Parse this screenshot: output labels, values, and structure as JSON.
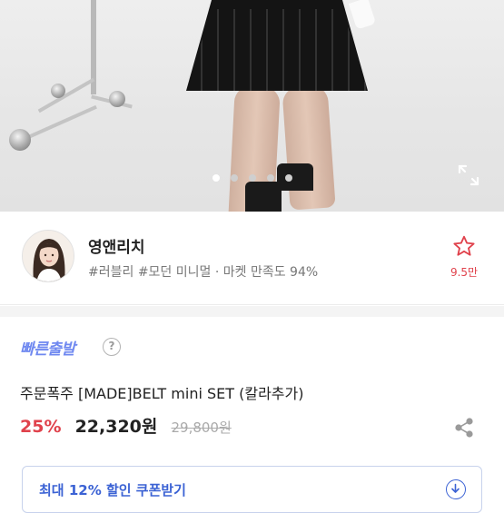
{
  "gallery": {
    "slide_count": 5,
    "active_index": 0
  },
  "seller": {
    "name": "영앤리치",
    "tags": "#러블리 #모던 미니멀 · 마켓 만족도 94%",
    "wish_count": "9.5만"
  },
  "product": {
    "badge": "빠른출발",
    "help_symbol": "?",
    "title": "주문폭주 [MADE]BELT mini SET (칼라추가)",
    "discount": "25%",
    "price": "22,320원",
    "original_price": "29,800원"
  },
  "coupon": {
    "label": "최대 12% 할인 쿠폰받기"
  },
  "colors": {
    "accent_red": "#e0424c",
    "badge_blue": "#6f88f0",
    "coupon_blue": "#3b62d4"
  },
  "icons": {
    "expand": "expand-icon",
    "wish": "star-icon",
    "share": "share-icon",
    "help": "question-icon",
    "coupon": "download-icon"
  }
}
